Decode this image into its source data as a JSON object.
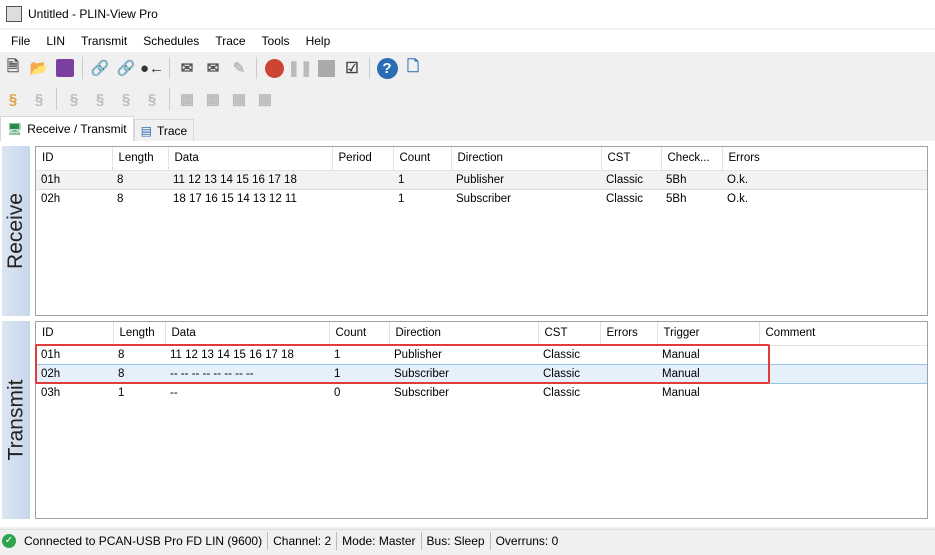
{
  "window": {
    "title": "Untitled - PLIN-View Pro"
  },
  "menu": [
    "File",
    "LIN",
    "Transmit",
    "Schedules",
    "Trace",
    "Tools",
    "Help"
  ],
  "tabs": [
    {
      "label": "Receive / Transmit"
    },
    {
      "label": "Trace"
    }
  ],
  "receive": {
    "label": "Receive",
    "columns": [
      "ID",
      "Length",
      "Data",
      "Period",
      "Count",
      "Direction",
      "CST",
      "Check...",
      "Errors"
    ],
    "rows": [
      [
        "01h",
        "8",
        "11 12 13 14 15 16 17 18",
        "",
        "1",
        "Publisher",
        "Classic",
        "5Bh",
        "O.k."
      ],
      [
        "02h",
        "8",
        "18 17 16 15 14 13 12 11",
        "",
        "1",
        "Subscriber",
        "Classic",
        "5Bh",
        "O.k."
      ]
    ]
  },
  "transmit": {
    "label": "Transmit",
    "columns": [
      "ID",
      "Length",
      "Data",
      "Count",
      "Direction",
      "CST",
      "Errors",
      "Trigger",
      "Comment"
    ],
    "rows": [
      [
        "01h",
        "8",
        "11 12 13 14 15 16 17 18",
        "1",
        "Publisher",
        "Classic",
        "",
        "Manual",
        ""
      ],
      [
        "02h",
        "8",
        "-- -- -- -- -- -- -- --",
        "1",
        "Subscriber",
        "Classic",
        "",
        "Manual",
        ""
      ],
      [
        "03h",
        "1",
        "--",
        "0",
        "Subscriber",
        "Classic",
        "",
        "Manual",
        ""
      ]
    ]
  },
  "status": {
    "connection": "Connected to PCAN-USB Pro FD LIN (9600)",
    "channel": "Channel: 2",
    "mode": "Mode: Master",
    "bus": "Bus: Sleep",
    "overruns": "Overruns: 0"
  }
}
